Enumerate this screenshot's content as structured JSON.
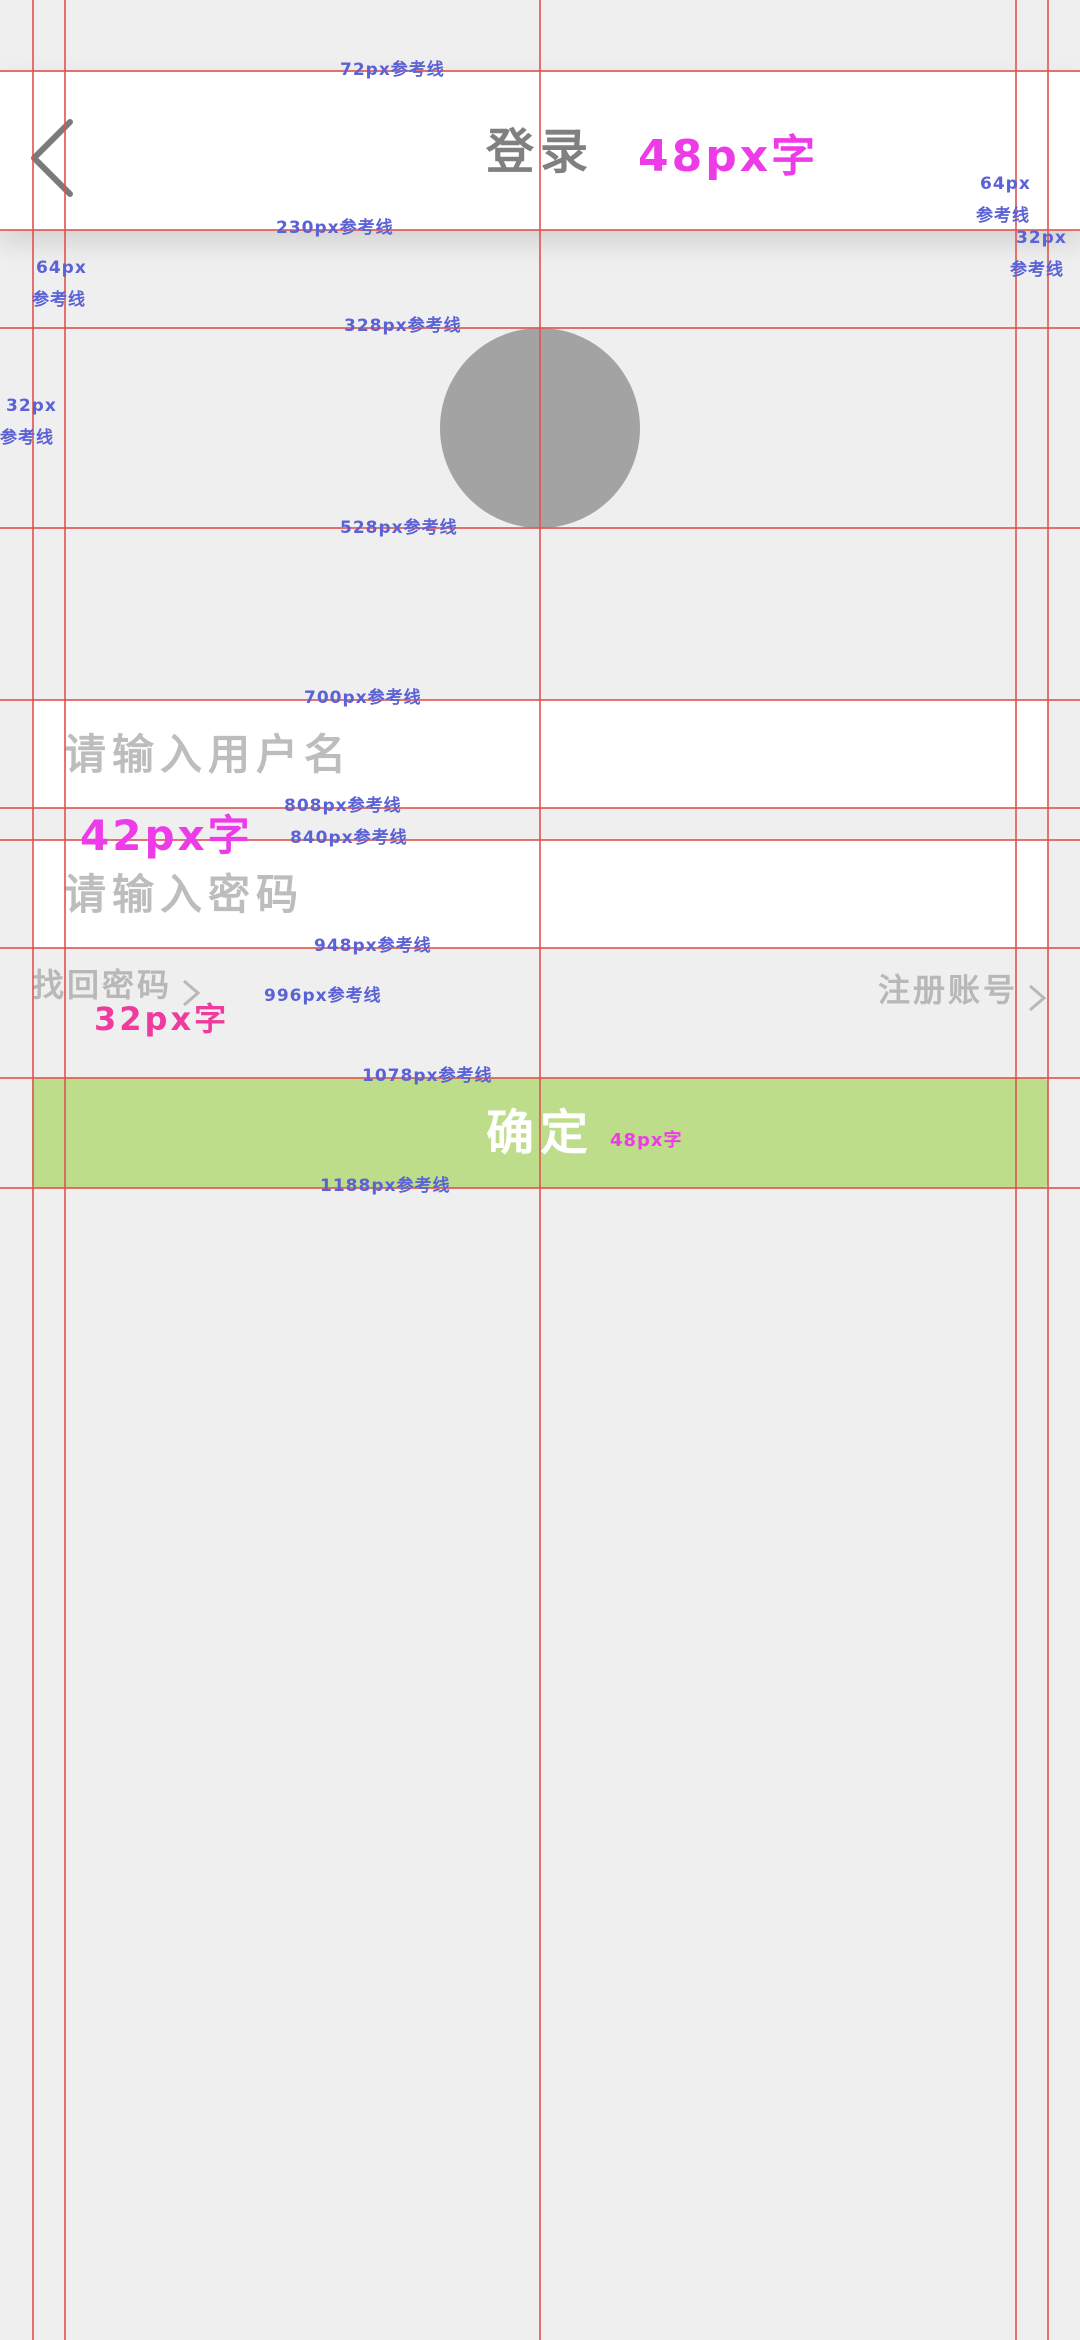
{
  "header": {
    "back_icon": "chevron-left-icon",
    "title": "登录"
  },
  "avatar": {
    "color": "#a3a3a3"
  },
  "form": {
    "username_placeholder": "请输入用户名",
    "password_placeholder": "请输入密码"
  },
  "links": {
    "forgot_password": "找回密码",
    "register": "注册账号",
    "chevron_icon": "chevron-right-icon"
  },
  "confirm_button": {
    "label": "确定",
    "color": "#bedd8b"
  },
  "guides": {
    "color": "#e0524e",
    "notes": {
      "g72": "72px参考线",
      "g230": "230px参考线",
      "g328": "328px参考线",
      "g528": "528px参考线",
      "g700": "700px参考线",
      "g808": "808px参考线",
      "g840": "840px参考线",
      "g948": "948px参考线",
      "g996": "996px参考线",
      "g1078": "1078px参考线",
      "g1188": "1188px参考线",
      "left64_a": "64px",
      "left64_b": "参考线",
      "left32_a": "32px",
      "left32_b": "参考线",
      "right64_a": "64px",
      "right64_b": "参考线",
      "right32_a": "32px",
      "right32_b": "参考线"
    },
    "font_notes": {
      "title_size": "48px字",
      "input_size": "42px字",
      "link_size": "32px字",
      "button_size": "48px字"
    }
  }
}
